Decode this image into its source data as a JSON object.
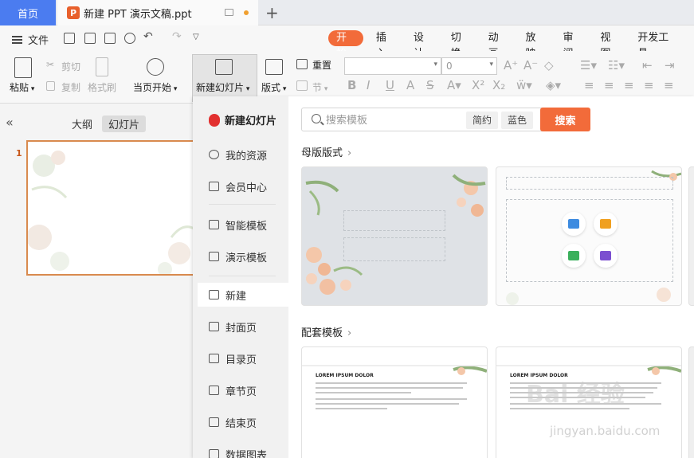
{
  "tabs": {
    "home": "首页",
    "document": "新建 PPT 演示文稿.ppt",
    "ppt_logo": "P",
    "add_tab": "+"
  },
  "menu": {
    "file": "文件",
    "ribbon_tabs": [
      "开始",
      "插入",
      "设计",
      "切换",
      "动画",
      "放映",
      "审阅",
      "视图",
      "开发工具"
    ],
    "active_tab": "开始"
  },
  "ribbon": {
    "paste": "粘贴",
    "cut": "剪切",
    "copy": "复制",
    "format_painter": "格式刷",
    "from_current": "当页开始",
    "new_slide": "新建幻灯片",
    "layout": "版式",
    "reset": "重置",
    "section": "节",
    "font_name": "",
    "font_size": "0"
  },
  "left_panel": {
    "outline_tab": "大纲",
    "slides_tab": "幻灯片",
    "slide_number": "1"
  },
  "new_slide_panel": {
    "header": "新建幻灯片",
    "categories": [
      {
        "label": "我的资源",
        "icon": "user-icon"
      },
      {
        "label": "会员中心",
        "icon": "diamond-icon"
      },
      {
        "label": "智能模板",
        "icon": "cube-icon"
      },
      {
        "label": "演示模板",
        "icon": "layout-icon"
      },
      {
        "label": "新建",
        "icon": "new-icon"
      },
      {
        "label": "封面页",
        "icon": "cover-icon"
      },
      {
        "label": "目录页",
        "icon": "toc-icon"
      },
      {
        "label": "章节页",
        "icon": "chapter-icon"
      },
      {
        "label": "结束页",
        "icon": "end-icon"
      },
      {
        "label": "数据图表",
        "icon": "chart-icon"
      }
    ],
    "active_category": "新建",
    "search": {
      "placeholder": "搜索模板",
      "filter_1": "简约",
      "filter_2": "蓝色",
      "button": "搜索"
    },
    "section_master": "母版版式",
    "section_matching": "配套模板",
    "template_heading": "LOREM IPSUM DOLOR"
  },
  "colors": {
    "accent": "#f26b3a",
    "home_tab": "#4b7cf0",
    "slide_border": "#d98a4e"
  },
  "watermark": {
    "main": "Bai 经验",
    "sub": "jingyan.baidu.com"
  }
}
